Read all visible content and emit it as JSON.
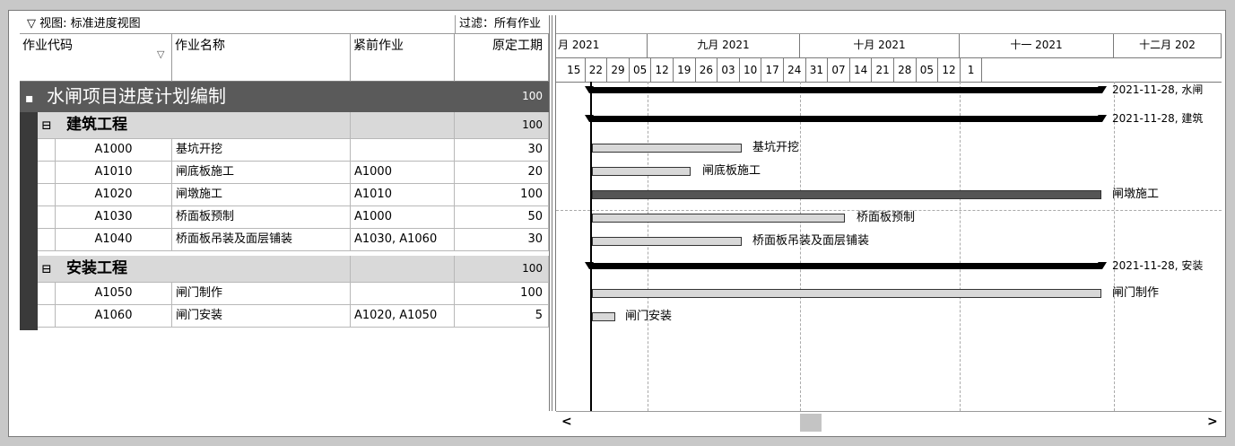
{
  "view_bar": {
    "label": "▽ 视图: 标准进度视图"
  },
  "filter_bar": {
    "label": "过滤：所有作业"
  },
  "columns": {
    "code": "作业代码",
    "name": "作业名称",
    "pred": "紧前作业",
    "dur": "原定工期",
    "sort_glyph": "▽"
  },
  "project": {
    "toggle": "▪",
    "title": "水闸项目进度计划编制",
    "duration": "100"
  },
  "groups": [
    {
      "toggle": "⊟",
      "title": "建筑工程",
      "duration": "100"
    },
    {
      "toggle": "⊟",
      "title": "安装工程",
      "duration": "100"
    }
  ],
  "activities": [
    {
      "code": "A1000",
      "name": "基坑开挖",
      "pred": "",
      "dur": "30"
    },
    {
      "code": "A1010",
      "name": "闸底板施工",
      "pred": "A1000",
      "dur": "20"
    },
    {
      "code": "A1020",
      "name": "闸墩施工",
      "pred": "A1010",
      "dur": "100"
    },
    {
      "code": "A1030",
      "name": "桥面板预制",
      "pred": "A1000",
      "dur": "50"
    },
    {
      "code": "A1040",
      "name": "桥面板吊装及面层铺装",
      "pred": "A1030, A1060",
      "dur": "30"
    },
    {
      "code": "A1050",
      "name": "闸门制作",
      "pred": "",
      "dur": "100"
    },
    {
      "code": "A1060",
      "name": "闸门安装",
      "pred": "A1020, A1050",
      "dur": "5"
    }
  ],
  "timeline": {
    "months": [
      "月 2021",
      "九月 2021",
      "十月 2021",
      "十一 2021",
      "十二月 202"
    ],
    "weeks": [
      "15",
      "22",
      "29",
      "05",
      "12",
      "19",
      "26",
      "03",
      "10",
      "17",
      "24",
      "31",
      "07",
      "14",
      "21",
      "28",
      "05",
      "12",
      "1"
    ]
  },
  "gantt_labels": {
    "project": "2021-11-28, 水闸",
    "group1": "2021-11-28, 建筑",
    "group2": "2021-11-28, 安装",
    "a1000": "基坑开挖",
    "a1010": "闸底板施工",
    "a1020": "闸墩施工",
    "a1030": "桥面板预制",
    "a1040": "桥面板吊装及面层铺装",
    "a1050": "闸门制作",
    "a1060": "闸门安装"
  },
  "scrollbar": {
    "left_arrow": "<",
    "right_arrow": ">"
  }
}
